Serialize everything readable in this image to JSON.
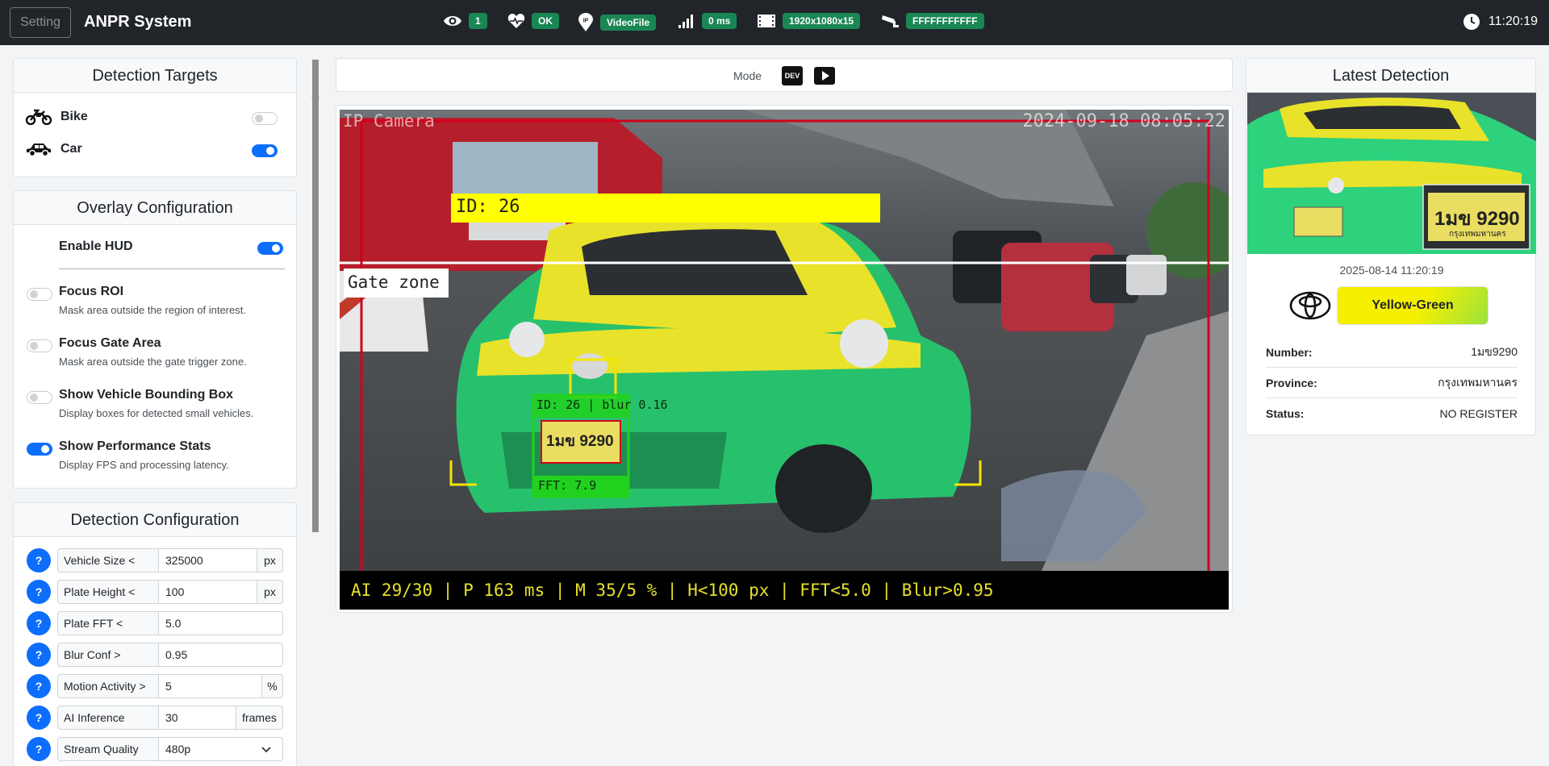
{
  "topbar": {
    "setting_label": "Setting",
    "title": "ANPR System",
    "status": [
      {
        "icon": "eye-icon",
        "value": "1"
      },
      {
        "icon": "heart-pulse-icon",
        "value": "OK"
      },
      {
        "icon": "ip-location-icon",
        "value": "VideoFile"
      },
      {
        "icon": "signal-icon",
        "value": "0 ms"
      },
      {
        "icon": "film-icon",
        "value": "1920x1080x15"
      },
      {
        "icon": "cctv-camera-icon",
        "value": "FFFFFFFFFFF"
      }
    ],
    "time": "11:20:19"
  },
  "detection_targets": {
    "title": "Detection Targets",
    "items": [
      {
        "icon": "motorcycle-icon",
        "label": "Bike",
        "enabled": false
      },
      {
        "icon": "car-icon",
        "label": "Car",
        "enabled": true
      }
    ]
  },
  "overlay": {
    "title": "Overlay Configuration",
    "enable_hud_label": "Enable HUD",
    "enable_hud": true,
    "items": [
      {
        "label": "Focus ROI",
        "desc": "Mask area outside the region of interest.",
        "enabled": false
      },
      {
        "label": "Focus Gate Area",
        "desc": "Mask area outside the gate trigger zone.",
        "enabled": false
      },
      {
        "label": "Show Vehicle Bounding Box",
        "desc": "Display boxes for detected small vehicles.",
        "enabled": false
      },
      {
        "label": "Show Performance Stats",
        "desc": "Display FPS and processing latency.",
        "enabled": true
      }
    ]
  },
  "detection_config": {
    "title": "Detection Configuration",
    "help_label": "?",
    "rows": [
      {
        "label": "Vehicle Size <",
        "value": "325000",
        "unit": "px"
      },
      {
        "label": "Plate Height <",
        "value": "100",
        "unit": "px"
      },
      {
        "label": "Plate FFT <",
        "value": "5.0",
        "unit": ""
      },
      {
        "label": "Blur Conf >",
        "value": "0.95",
        "unit": ""
      },
      {
        "label": "Motion Activity >",
        "value": "5",
        "unit": "%"
      },
      {
        "label": "AI Inference",
        "value": "30",
        "unit": "frames"
      },
      {
        "label": "Stream Quality",
        "value": "480p",
        "unit": ""
      }
    ]
  },
  "mode": {
    "label": "Mode",
    "dev_label": "DEV"
  },
  "video": {
    "camera_label": "IP Camera",
    "timestamp": "2024-09-18 08:05:22",
    "vehicle_id_label": "ID: 26",
    "gate_label": "Gate zone",
    "plate_box_label": "ID: 26 | blur 0.16",
    "plate_text": "1มข 9290",
    "fft_label": "FFT: 7.9",
    "hud_text": "AI 29/30 | P 163 ms | M 35/5 % | H<100 px | FFT<5.0 | Blur>0.95",
    "colors": {
      "roi": "#d0021b",
      "vehicle_label_bg": "#ffff00",
      "plate_box": "#22d11e",
      "hud_text": "#e5e02a"
    }
  },
  "latest": {
    "title": "Latest Detection",
    "plate_text": "1มข 9290",
    "plate_province": "กรุงเทพมหานคร",
    "timestamp": "2025-08-14 11:20:19",
    "brand_icon": "toyota-logo-icon",
    "color_label": "Yellow-Green",
    "number_key": "Number:",
    "number_val": "1มข9290",
    "province_key": "Province:",
    "province_val": "กรุงเทพมหานคร",
    "status_key": "Status:",
    "status_val": "NO REGISTER"
  }
}
